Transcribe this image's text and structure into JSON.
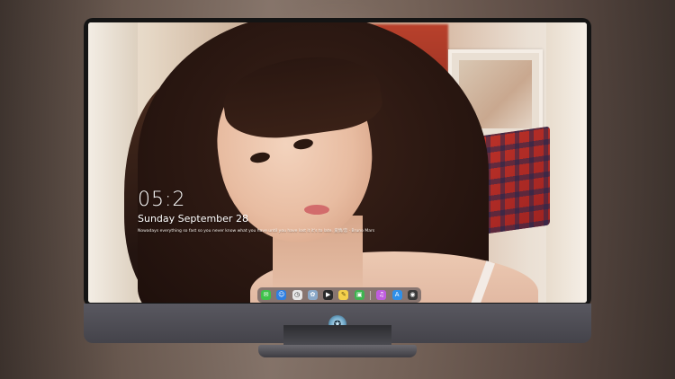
{
  "lock_screen": {
    "time": "05:2",
    "date": "Sunday September  28",
    "quote": "Nowadays everything so fast so you never know what you have until you have lost it it's to late. 爱情/恋 · Bruno Mars"
  },
  "dock": {
    "items": [
      {
        "name": "messages",
        "glyph": "✉",
        "color": "#3fc14a"
      },
      {
        "name": "finder",
        "glyph": "☺",
        "color": "#2f7fe0"
      },
      {
        "name": "clock",
        "glyph": "◷",
        "color": "#e7e7e7"
      },
      {
        "name": "photos",
        "glyph": "✿",
        "color": "#8aa8c8"
      },
      {
        "name": "clapper",
        "glyph": "▶",
        "color": "#2a2a2a"
      },
      {
        "name": "notes",
        "glyph": "✎",
        "color": "#f3d04b"
      },
      {
        "name": "facetime",
        "glyph": "▣",
        "color": "#3fb350"
      },
      {
        "name": "itunes",
        "glyph": "♫",
        "color": "#c05de0"
      },
      {
        "name": "appstore",
        "glyph": "A",
        "color": "#2f8fe8"
      },
      {
        "name": "camera",
        "glyph": "◉",
        "color": "#3a3a3a"
      }
    ]
  },
  "monitor": {
    "logo_glyph": "✪"
  },
  "colors": {
    "bezel": "#141414",
    "chin": "#4e4d54",
    "text": "#ffffff"
  }
}
